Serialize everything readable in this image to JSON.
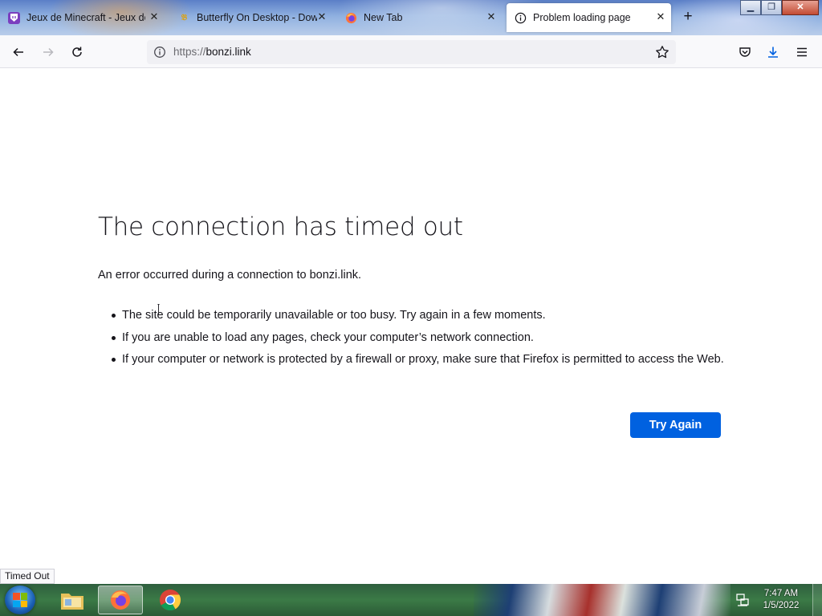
{
  "browser": {
    "tabs": [
      {
        "title": "Jeux de Minecraft - Jeux de Mi",
        "favicon": "twitch-shield-icon",
        "active": false
      },
      {
        "title": "Butterfly On Desktop - Downl",
        "favicon": "butterfly-site-icon",
        "active": false
      },
      {
        "title": "New Tab",
        "favicon": "firefox-icon",
        "active": false
      },
      {
        "title": "Problem loading page",
        "favicon": "info-icon",
        "active": true
      }
    ],
    "url": {
      "protocol": "https://",
      "host": "bonzi.link"
    }
  },
  "error_page": {
    "title": "The connection has timed out",
    "description": "An error occurred during a connection to bonzi.link.",
    "suggestions": [
      "The site could be temporarily unavailable or too busy. Try again in a few moments.",
      "If you are unable to load any pages, check your computer’s network connection.",
      "If your computer or network is protected by a firewall or proxy, make sure that Firefox is permitted to access the Web."
    ],
    "try_again_label": "Try Again"
  },
  "status_bar": {
    "text": "Timed Out"
  },
  "taskbar": {
    "apps": [
      "file-explorer-icon",
      "firefox-icon",
      "chrome-icon"
    ],
    "clock": {
      "time": "7:47 AM",
      "date": "1/5/2022"
    }
  },
  "colors": {
    "accent": "#0061e0",
    "text": "#15141a",
    "toolbar": "#f9f9fb"
  }
}
